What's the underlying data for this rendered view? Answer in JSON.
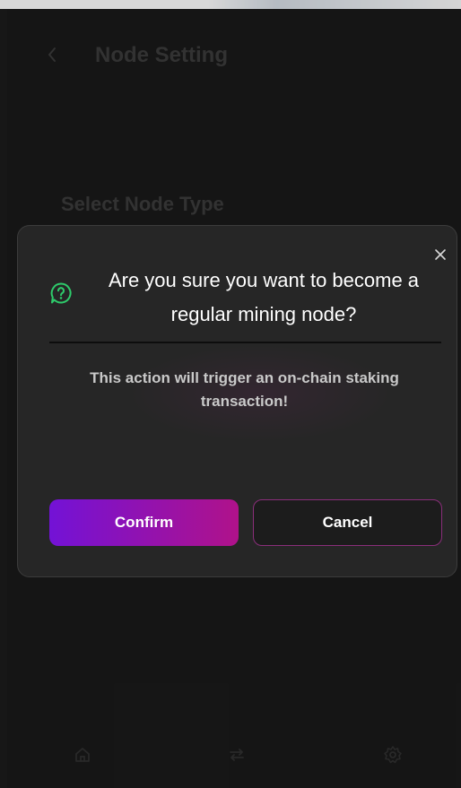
{
  "header": {
    "back_icon": "chevron-left-icon",
    "title": "Node Setting"
  },
  "main": {
    "section_label": "Select Node Type"
  },
  "tabbar": {
    "items": [
      {
        "icon": "home-icon"
      },
      {
        "icon": "swap-arrows-icon"
      },
      {
        "icon": "settings-gear-icon"
      }
    ]
  },
  "dialog": {
    "title": "Are you sure you want to become a regular mining node?",
    "message": "This action will trigger an on-chain staking transaction!",
    "icon": "question-bubble-icon",
    "close_icon": "close-icon",
    "confirm_label": "Confirm",
    "cancel_label": "Cancel"
  },
  "colors": {
    "background": "#191919",
    "dialog_background": "#262626",
    "accent_green": "#2ecb6b",
    "confirm_gradient_start": "#7312d6",
    "confirm_gradient_end": "#b0128a",
    "cancel_border": "#8a2e7a"
  }
}
